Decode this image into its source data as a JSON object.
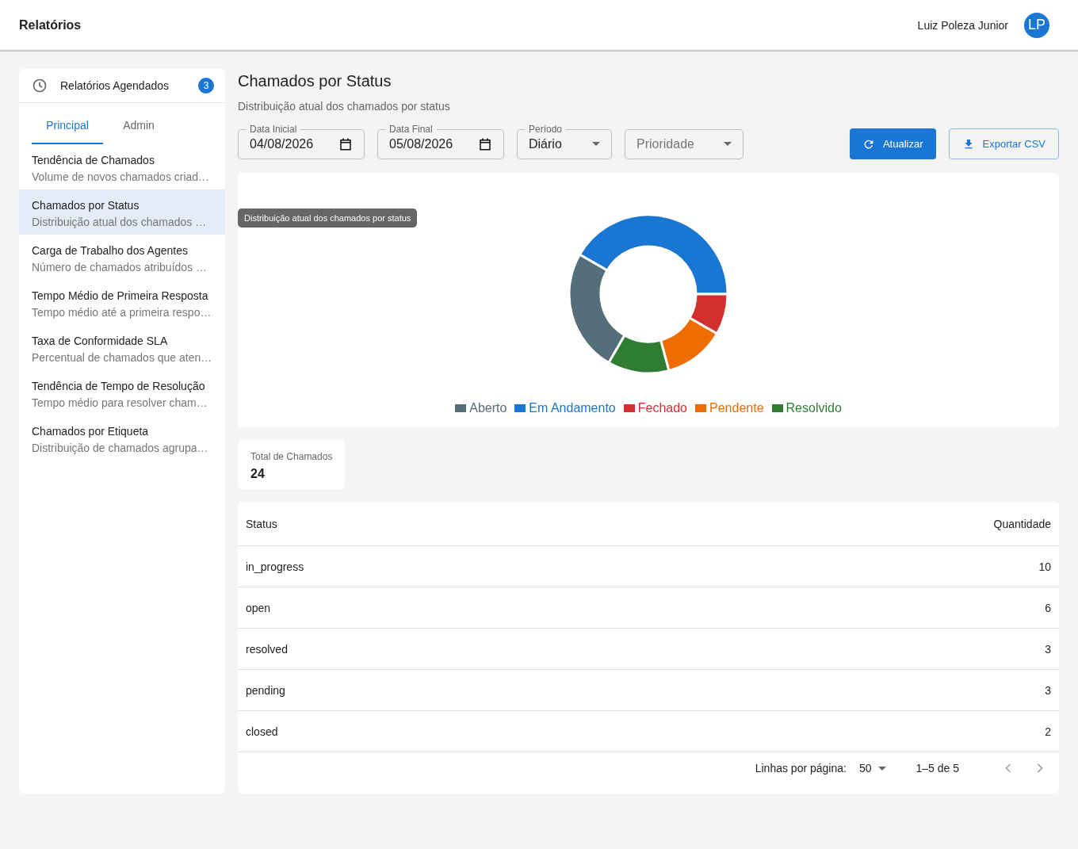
{
  "header": {
    "title": "Relatórios",
    "user_name": "Luiz Poleza Junior",
    "avatar_initials": "LP"
  },
  "sidebar": {
    "scheduled": {
      "label": "Relatórios Agendados",
      "count": "3"
    },
    "tabs": [
      {
        "label": "Principal",
        "selected": true
      },
      {
        "label": "Admin",
        "selected": false
      }
    ],
    "items": [
      {
        "title": "Tendência de Chamados",
        "subtitle": "Volume de novos chamados criad…",
        "selected": false
      },
      {
        "title": "Chamados por Status",
        "subtitle": "Distribuição atual dos chamados …",
        "selected": true
      },
      {
        "title": "Carga de Trabalho dos Agentes",
        "subtitle": "Número de chamados atribuídos …",
        "selected": false
      },
      {
        "title": "Tempo Médio de Primeira Resposta",
        "subtitle": "Tempo médio até a primeira respo…",
        "selected": false
      },
      {
        "title": "Taxa de Conformidade SLA",
        "subtitle": "Percentual de chamados que aten…",
        "selected": false
      },
      {
        "title": "Tendência de Tempo de Resolução",
        "subtitle": "Tempo médio para resolver cham…",
        "selected": false
      },
      {
        "title": "Chamados por Etiqueta",
        "subtitle": "Distribuição de chamados agrupa…",
        "selected": false
      }
    ]
  },
  "tooltip": "Distribuição atual dos chamados por status",
  "report": {
    "title": "Chamados por Status",
    "subtitle": "Distribuição atual dos chamados por status",
    "filters": [
      {
        "kind": "date",
        "label": "Data Inicial",
        "value": "04/08/2026"
      },
      {
        "kind": "date",
        "label": "Data Final",
        "value": "05/08/2026"
      },
      {
        "kind": "select",
        "label": "Período",
        "value": "Diário"
      },
      {
        "kind": "select",
        "placeholder": "Prioridade"
      }
    ],
    "buttons": [
      {
        "kind": "primary",
        "label": "Atualizar"
      },
      {
        "kind": "outlined",
        "label": "Exportar CSV"
      }
    ],
    "chart_data": {
      "type": "donut",
      "categories": [
        "Aberto",
        "Em Andamento",
        "Fechado",
        "Pendente",
        "Resolvido"
      ],
      "values": [
        25,
        41.67,
        8.33,
        12.5,
        12.5
      ],
      "colors": [
        "#546e7a",
        "#1976d2",
        "#d32f2f",
        "#ef6c00",
        "#2e7d32"
      ]
    },
    "total": {
      "label": "Total de Chamados",
      "value": "24"
    },
    "table": {
      "columns": [
        "Status",
        "Quantidade"
      ],
      "rows": [
        [
          "in_progress",
          "10"
        ],
        [
          "open",
          "6"
        ],
        [
          "resolved",
          "3"
        ],
        [
          "pending",
          "3"
        ],
        [
          "closed",
          "2"
        ]
      ]
    },
    "pagination": {
      "rows_label": "Linhas por página:",
      "rows_value": "50",
      "range": "1–5 de 5"
    }
  }
}
